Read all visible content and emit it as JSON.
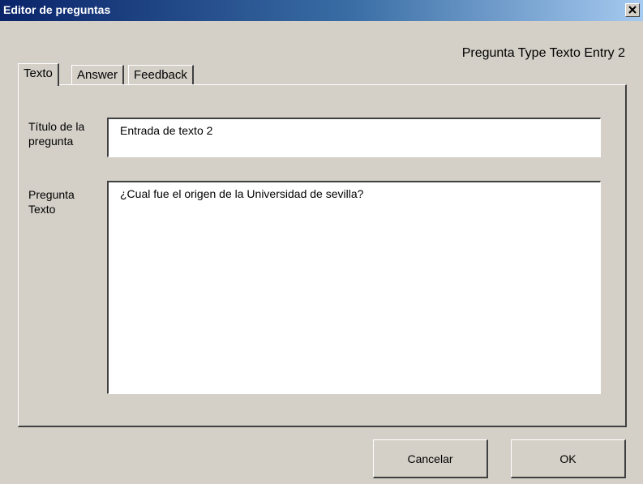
{
  "window": {
    "title": "Editor de preguntas",
    "close_symbol": "close-icon"
  },
  "header": {
    "type_label": "Pregunta Type Texto Entry 2"
  },
  "tabs": [
    {
      "label": "Texto",
      "active": true
    },
    {
      "label": "Answer",
      "active": false
    },
    {
      "label": "Feedback",
      "active": false
    }
  ],
  "form": {
    "title_label_line1": "Título de la",
    "title_label_line2": "pregunta",
    "title_value": "Entrada de texto 2",
    "question_label_line1": "Pregunta",
    "question_label_line2": "Texto",
    "question_value": "¿Cual fue el origen de la Universidad de sevilla?"
  },
  "buttons": {
    "cancel": "Cancelar",
    "ok": "OK"
  },
  "colors": {
    "face": "#d4d0c8",
    "title_start": "#0a246a",
    "title_end": "#a6caf0"
  }
}
